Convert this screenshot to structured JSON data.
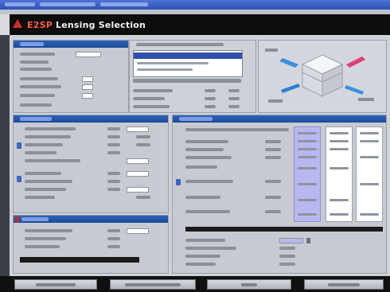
{
  "app": {
    "title_brand": "E2SP",
    "title_text": "Lensing Selection"
  },
  "colors": {
    "title_bar": "#2c52b8",
    "header_bg": "#0d0d0d",
    "accent_red": "#d42a2a",
    "section_header": "#1c4a98",
    "highlight_column": "#b6b8ef",
    "footer_bg": "#101010"
  },
  "icons": {
    "logo": "brand-triangle-icon",
    "lock": "lock-icon",
    "spinner": "spinner-arrows-icon",
    "pallet_diagram": "stack-pallet-diagram-icon"
  }
}
